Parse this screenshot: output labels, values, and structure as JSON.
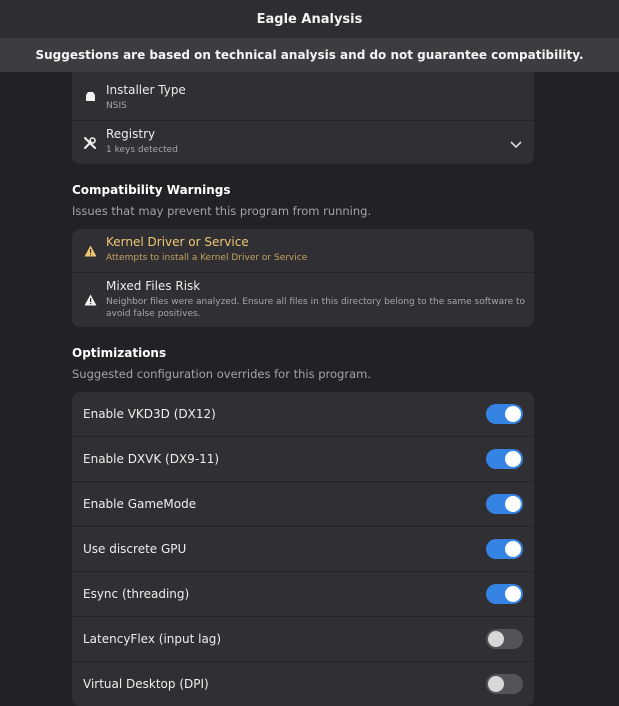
{
  "window": {
    "title": "Eagle Analysis"
  },
  "banner": {
    "text": "Suggestions are based on technical analysis and do not guarantee compatibility."
  },
  "info": {
    "installer": {
      "label": "Installer Type",
      "value": "NSIS"
    },
    "registry": {
      "label": "Registry",
      "value": "1 keys detected"
    }
  },
  "warnings": {
    "title": "Compatibility Warnings",
    "subtitle": "Issues that may prevent this program from running.",
    "items": [
      {
        "title": "Kernel Driver or Service",
        "desc": "Attempts to install a Kernel Driver or Service"
      },
      {
        "title": "Mixed Files Risk",
        "desc_line1": "Neighbor files were analyzed. Ensure all files in this directory belong to the same software to",
        "desc_line2": "avoid false positives."
      }
    ]
  },
  "optimizations": {
    "title": "Optimizations",
    "subtitle": "Suggested configuration overrides for this program.",
    "items": [
      {
        "label": "Enable VKD3D (DX12)",
        "enabled": true
      },
      {
        "label": "Enable DXVK (DX9-11)",
        "enabled": true
      },
      {
        "label": "Enable GameMode",
        "enabled": true
      },
      {
        "label": "Use discrete GPU",
        "enabled": true
      },
      {
        "label": "Esync (threading)",
        "enabled": true
      },
      {
        "label": "LatencyFlex (input lag)",
        "enabled": false
      },
      {
        "label": "Virtual Desktop (DPI)",
        "enabled": false
      }
    ]
  },
  "colors": {
    "accent": "#3584e4",
    "warning": "#f0c674",
    "card": "#303034",
    "background": "#222226"
  }
}
